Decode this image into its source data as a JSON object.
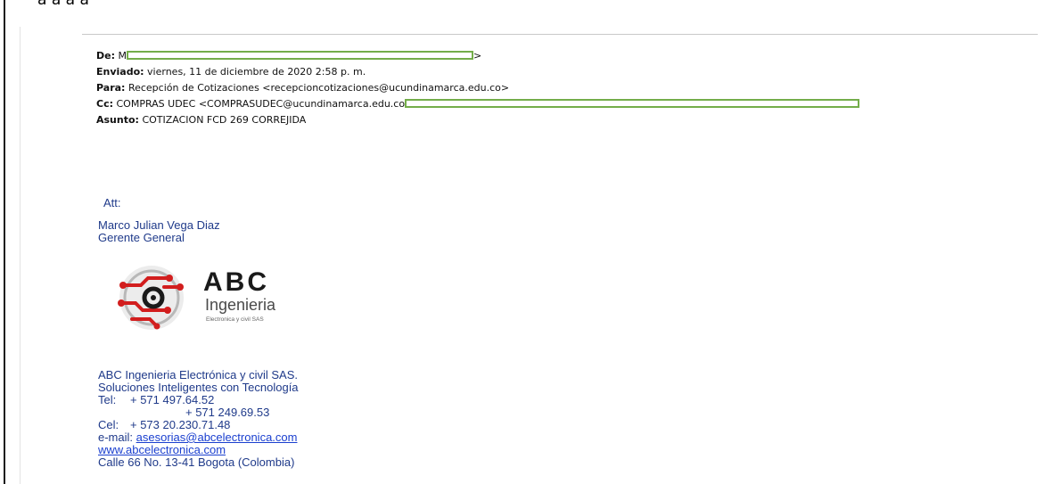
{
  "top_fragment": "a a a a",
  "email": {
    "from_label": "De:",
    "from_value": "M",
    "from_suffix": ">",
    "sent_label": "Enviado:",
    "sent_value": "viernes, 11 de diciembre de 2020 2:58 p. m.",
    "to_label": "Para:",
    "to_value": "Recepción de Cotizaciones <recepcioncotizaciones@ucundinamarca.edu.co>",
    "cc_label": "Cc:",
    "cc_value": "COMPRAS UDEC <COMPRASUDEC@ucundinamarca.edu.co",
    "subject_label": "Asunto:",
    "subject_value": "COTIZACION FCD 269 CORREJIDA"
  },
  "body": {
    "att": "Att:",
    "signer_name": "Marco Julian Vega Diaz",
    "signer_title": "Gerente General"
  },
  "logo": {
    "brand": "ABC",
    "name": "Ingenieria",
    "tagline": "Electronica y civil SAS",
    "colors": {
      "red": "#d21e1e",
      "dark": "#1a1a1a",
      "gray": "#9a9a9a"
    }
  },
  "company": {
    "name": "ABC Ingenieria Electrónica y civil SAS.",
    "slogan": "Soluciones Inteligentes con Tecnología",
    "tel_label": "Tel:",
    "tel_1": "+ 571 497.64.52",
    "tel_2": "+ 571 249.69.53",
    "cel_label": "Cel:",
    "cel": "+ 573 20.230.71.48",
    "email_label": "e-mail:",
    "email": "asesorias@abcelectronica.com",
    "website": "www.abcelectronica.com",
    "address": "Calle 66 No. 13-41 Bogota (Colombia)"
  }
}
